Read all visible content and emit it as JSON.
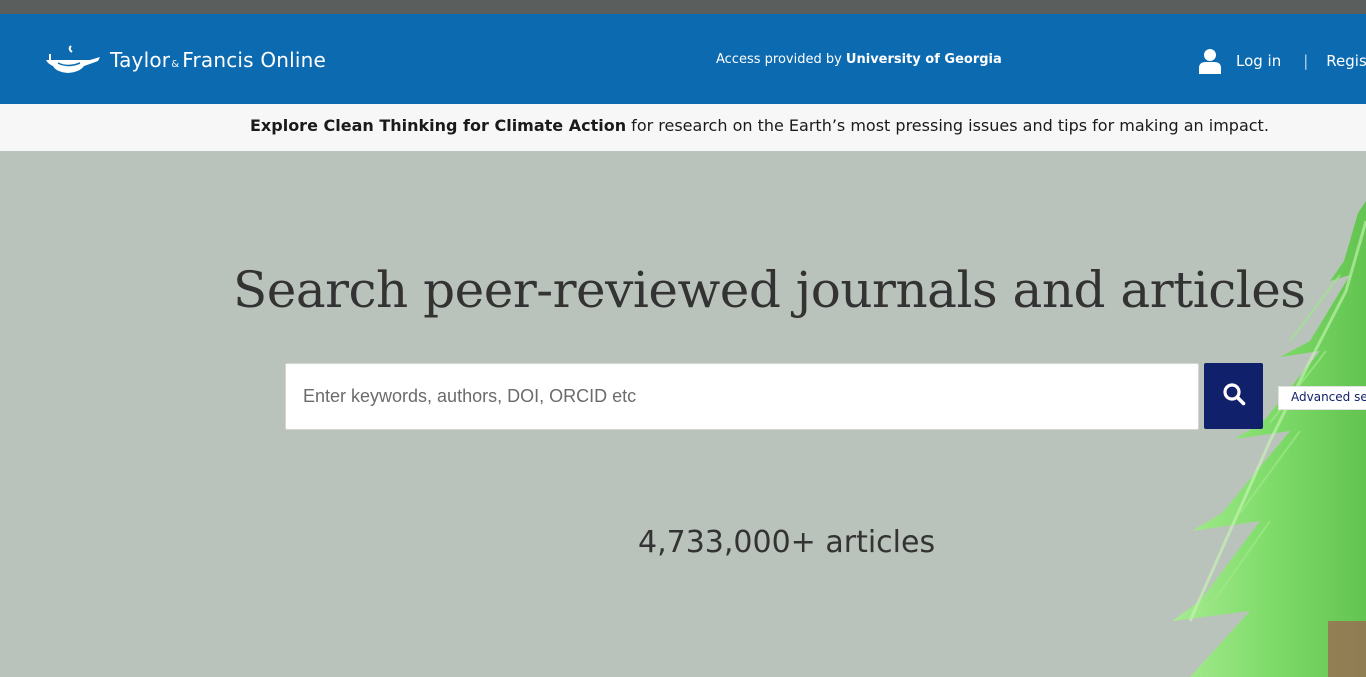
{
  "header": {
    "logo_text_1": "Taylor",
    "logo_amp": "&",
    "logo_text_2": "Francis Online",
    "access_prefix": "Access provided by ",
    "access_institution": "University of Georgia",
    "login_label": "Log in",
    "separator": "|",
    "register_label": "Register"
  },
  "banner": {
    "link_text": "Explore Clean Thinking for Climate Action",
    "rest_text": " for research on the Earth’s most pressing issues and tips for making an impact."
  },
  "hero": {
    "title": "Search peer-reviewed journals and articles",
    "search_placeholder": "Enter keywords, authors, DOI, ORCID etc",
    "advanced_label": "Advanced search",
    "article_count": "4,733,000+ articles"
  },
  "colors": {
    "header_bg": "#0c6ab1",
    "banner_bg": "#f7f7f7",
    "hero_bg": "#bac3bb",
    "search_button": "#10206b",
    "tree_green": "#7fe06a"
  },
  "icons": {
    "logo": "lamp-logo-icon",
    "user": "user-icon",
    "search": "search-icon"
  }
}
